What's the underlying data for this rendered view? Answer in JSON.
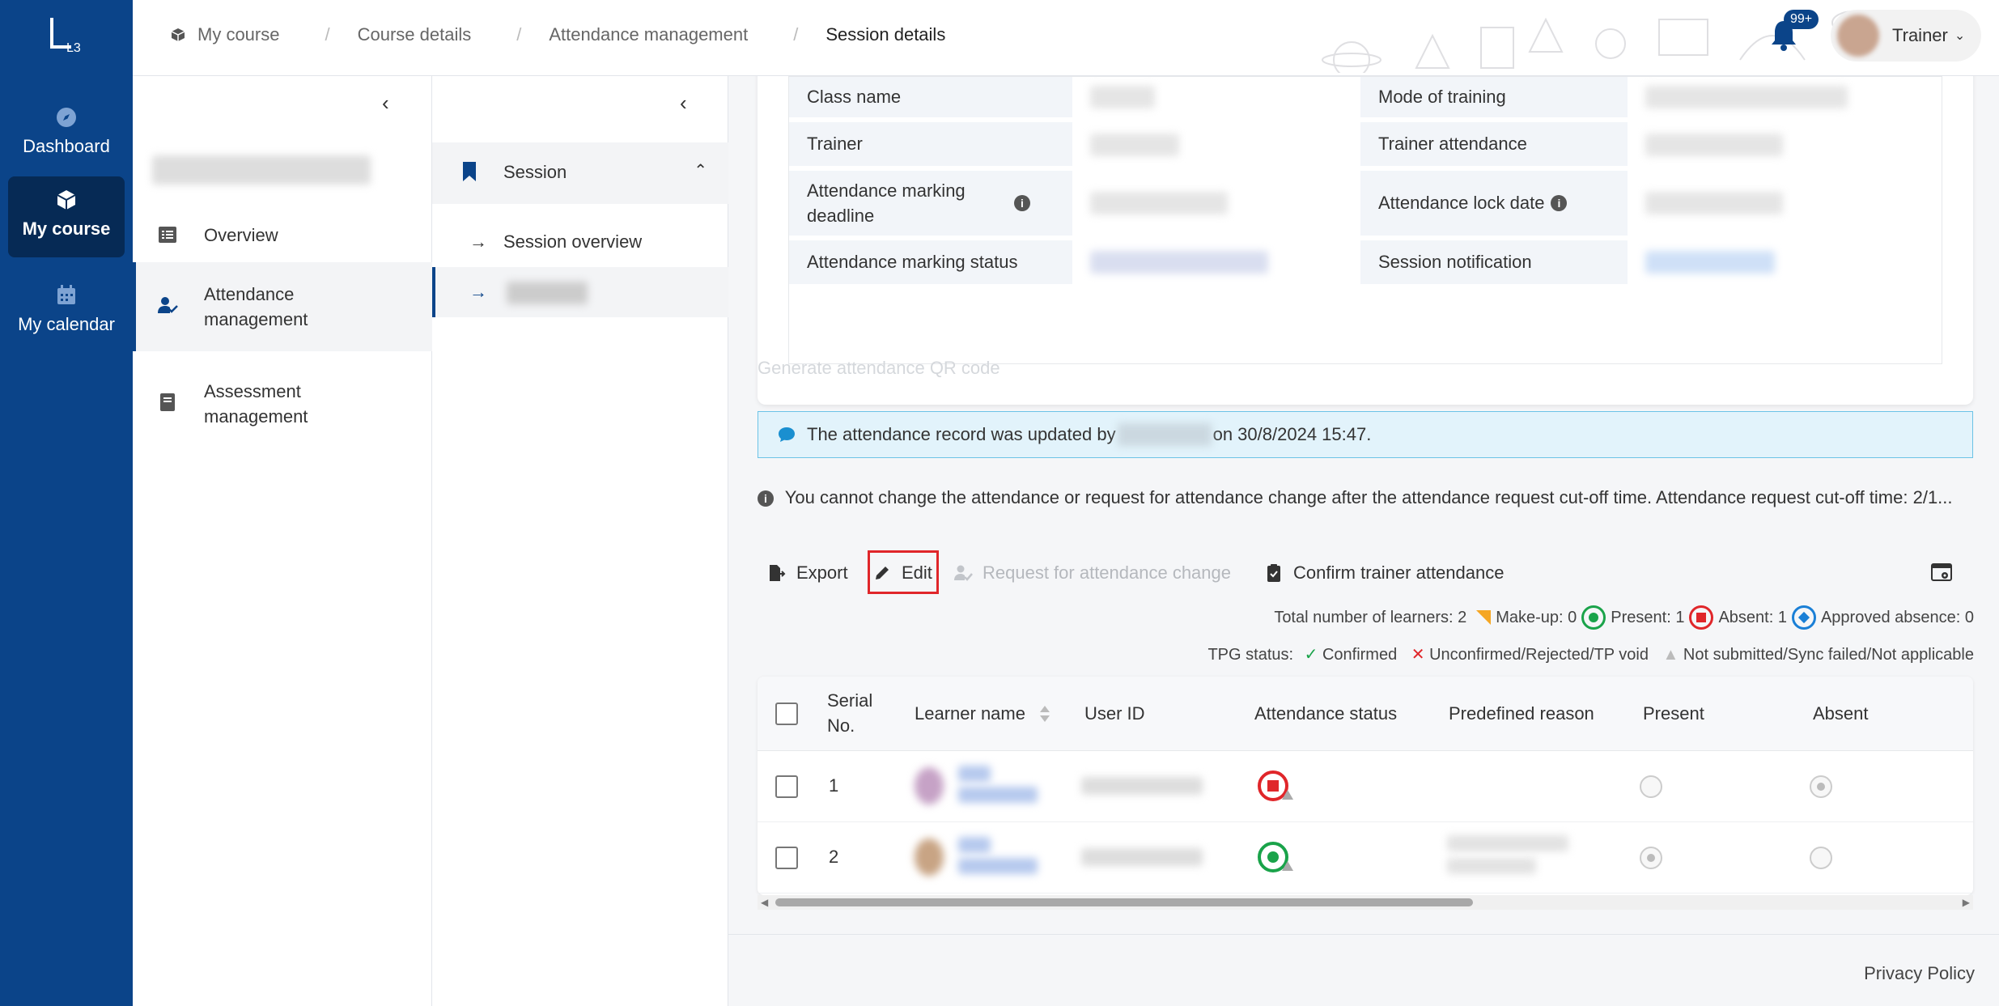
{
  "nav": {
    "logo_text": "L3",
    "items": [
      {
        "label": "Dashboard",
        "icon": "compass-icon"
      },
      {
        "label": "My course",
        "icon": "cube-icon",
        "active": true
      },
      {
        "label": "My calendar",
        "icon": "calendar-icon"
      }
    ]
  },
  "breadcrumb": [
    "My course",
    "Course details",
    "Attendance management",
    "Session details"
  ],
  "header": {
    "notif_badge": "99+",
    "user_label": "Trainer"
  },
  "course_menu": {
    "items": [
      {
        "label": "Overview"
      },
      {
        "label": "Attendance management",
        "active": true
      },
      {
        "label": "Assessment management"
      }
    ]
  },
  "session_menu": {
    "header": "Session",
    "items": [
      {
        "label": "Session overview"
      }
    ]
  },
  "session_info": {
    "rows": [
      {
        "left_label": "Class name",
        "right_label": "Mode of training"
      },
      {
        "left_label": "Trainer",
        "right_label": "Trainer attendance"
      },
      {
        "left_label": "Attendance marking deadline",
        "right_label": "Attendance lock date"
      },
      {
        "left_label": "Attendance marking status",
        "right_label": "Session notification"
      }
    ]
  },
  "qr_link": "Generate attendance QR code",
  "alert": {
    "prefix": "The attendance record was updated by",
    "suffix": "on 30/8/2024 15:47."
  },
  "warning": "You cannot change the attendance or request for attendance change after the attendance request cut-off time. Attendance request cut-off time: 2/1...",
  "toolbar": {
    "export": "Export",
    "edit": "Edit",
    "request": "Request for attendance change",
    "confirm": "Confirm trainer attendance"
  },
  "summary": {
    "total": "Total number of learners: 2",
    "makeup": "Make-up: 0",
    "present": "Present: 1",
    "absent": "Absent: 1",
    "approved": "Approved absence: 0"
  },
  "tpg": {
    "label": "TPG status:",
    "confirmed": "Confirmed",
    "unconfirmed": "Unconfirmed/Rejected/TP void",
    "not_submitted": "Not submitted/Sync failed/Not applicable"
  },
  "table": {
    "columns": [
      "Serial No.",
      "Learner name",
      "User ID",
      "Attendance status",
      "Predefined reason",
      "Present",
      "Absent"
    ],
    "rows": [
      {
        "serial": "1",
        "status": "absent",
        "present": false,
        "absent": true
      },
      {
        "serial": "2",
        "status": "present",
        "present": true,
        "absent": false
      }
    ]
  },
  "colors": {
    "brand": "#0b4489",
    "present": "#1aa34a",
    "absent": "#e0262a",
    "approved": "#1a7fd6",
    "makeup": "#f5a623"
  },
  "footer": {
    "privacy": "Privacy Policy"
  }
}
